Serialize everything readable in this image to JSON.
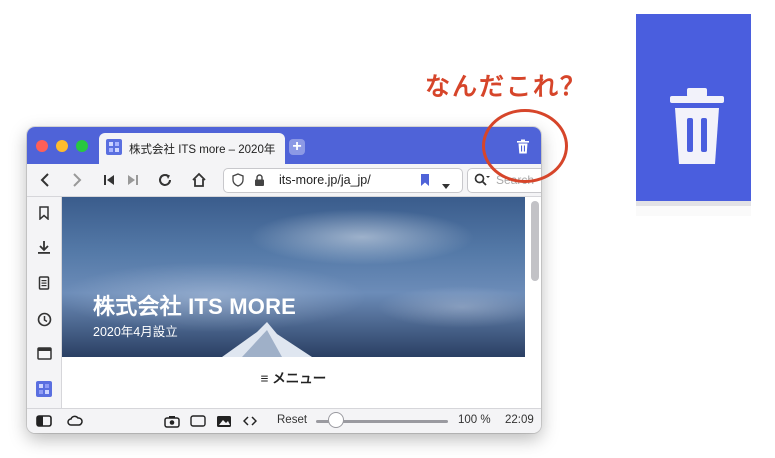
{
  "annotation": {
    "text": "なんだこれ？",
    "color": "#d6452a"
  },
  "browser": {
    "titlebar_color": "#4f63d8",
    "traffic_lights": [
      "#fe5f57",
      "#febc2e",
      "#28c840"
    ],
    "tab": {
      "title": "株式会社 ITS more – 2020年"
    },
    "toolbar": {
      "url": "its-more.jp/ja_jp/",
      "search_placeholder": "Search"
    },
    "sidebar": {
      "icons": [
        "bookmark-icon",
        "download-icon",
        "notes-icon",
        "history-icon",
        "window-icon",
        "favicon-panel-icon"
      ]
    },
    "page": {
      "hero_title": "株式会社 ITS MORE",
      "hero_subtitle": "2020年4月設立",
      "menu_label": "≡ メニュー"
    },
    "statusbar": {
      "reset_label": "Reset",
      "zoom": "100 %",
      "zoom_level": 0.15,
      "time": "22:09"
    }
  }
}
